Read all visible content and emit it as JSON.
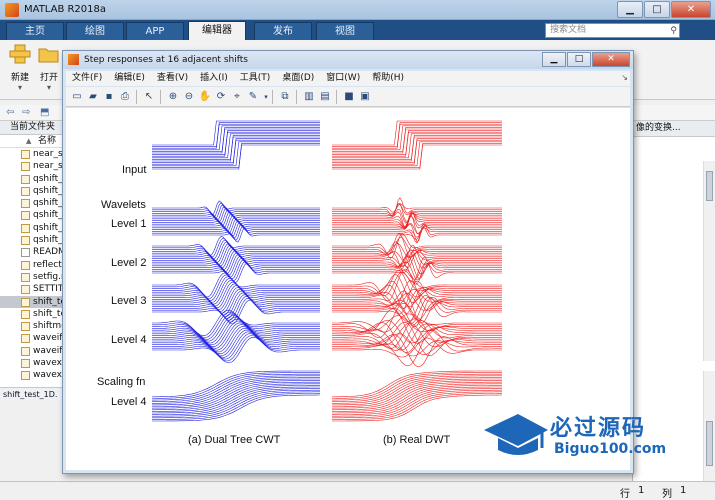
{
  "app": {
    "title": "MATLAB R2018a",
    "minimize": "▁",
    "maximize": "□",
    "close": "✕"
  },
  "tabs": [
    {
      "label": "主页"
    },
    {
      "label": "绘图"
    },
    {
      "label": "APP"
    },
    {
      "label": "编辑器"
    },
    {
      "label": "发布"
    },
    {
      "label": "视图"
    }
  ],
  "search": {
    "placeholder": "搜索文档"
  },
  "ribbon": {
    "new_label": "新建",
    "open_label": "打开"
  },
  "left_panel": {
    "title": "当前文件夹",
    "column_name": "名称",
    "files": [
      {
        "name": "near_s",
        "type": "m"
      },
      {
        "name": "near_s",
        "type": "m"
      },
      {
        "name": "qshift_",
        "type": "m"
      },
      {
        "name": "qshift_",
        "type": "m"
      },
      {
        "name": "qshift_",
        "type": "m"
      },
      {
        "name": "qshift_",
        "type": "m"
      },
      {
        "name": "qshift_",
        "type": "m"
      },
      {
        "name": "qshift_",
        "type": "m"
      },
      {
        "name": "READM",
        "type": "txt"
      },
      {
        "name": "reflect.",
        "type": "m"
      },
      {
        "name": "setfig.r",
        "type": "m"
      },
      {
        "name": "SETTIT",
        "type": "m"
      },
      {
        "name": "shift_te",
        "type": "m",
        "selected": true
      },
      {
        "name": "shift_te",
        "type": "m"
      },
      {
        "name": "shiftme",
        "type": "m"
      },
      {
        "name": "waveifi",
        "type": "m"
      },
      {
        "name": "waveifi",
        "type": "m"
      },
      {
        "name": "wavext",
        "type": "m"
      },
      {
        "name": "wavext",
        "type": "m"
      }
    ],
    "details": "shift_test_1D."
  },
  "right_panel": {
    "header": "像的变换..."
  },
  "status": {
    "row_label": "行",
    "row_value": "1",
    "col_label": "列",
    "col_value": "1"
  },
  "figure": {
    "title": "Step responses at 16 adjacent shifts",
    "menus": [
      {
        "label": "文件(F)"
      },
      {
        "label": "编辑(E)"
      },
      {
        "label": "查看(V)"
      },
      {
        "label": "插入(I)"
      },
      {
        "label": "工具(T)"
      },
      {
        "label": "桌面(D)"
      },
      {
        "label": "窗口(W)"
      },
      {
        "label": "帮助(H)"
      }
    ],
    "row_labels": {
      "input": "Input",
      "wavelets": "Wavelets",
      "level1": "Level 1",
      "level2": "Level 2",
      "level3": "Level 3",
      "level4": "Level 4",
      "scaling": "Scaling fn",
      "level4b": "Level 4"
    },
    "caption_left": "(a) Dual Tree CWT",
    "caption_right": "(b) Real DWT",
    "colors": {
      "left": "#2222e0",
      "right": "#ee2222"
    },
    "shifts": 16
  },
  "watermark": {
    "cn": "必过源码",
    "en": "Biguo100.com"
  }
}
